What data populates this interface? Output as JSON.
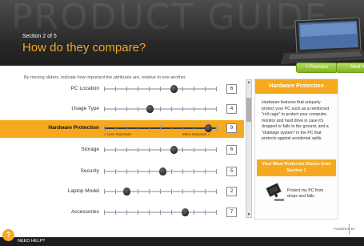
{
  "header": {
    "watermark": "PRODUCT GUIDE",
    "section_label": "Section 2 of 5",
    "title": "How do they compare?"
  },
  "instructions": "By moving sliders, indicate how important the attributes are, relative to one another.",
  "nav": {
    "previous_label": "< Previous",
    "next_label": "Next >"
  },
  "sliders": [
    {
      "label": "PC Location",
      "value": "6",
      "position": 0.62
    },
    {
      "label": "Usage Type",
      "value": "4",
      "position": 0.41
    },
    {
      "label": "Hardware Protection",
      "value": "9",
      "position": 0.93,
      "highlight": true,
      "less_label": "« Less Important",
      "more_label": "More Important »"
    },
    {
      "label": "Storage",
      "value": "6",
      "position": 0.62
    },
    {
      "label": "Security",
      "value": "5",
      "position": 0.52
    },
    {
      "label": "Laptop Model",
      "value": "2",
      "position": 0.2
    },
    {
      "label": "Accessories",
      "value": "7",
      "position": 0.72
    }
  ],
  "info_panel": {
    "title": "Hardware Protection",
    "body": "Hardware features that uniquely protect your PC such as a reinforced \"roll cage\" to protect your computer, monitor and hard drive in case it's dropped or falls to the ground, and a \"drainage system\" in the PC that protects against accidental spills.",
    "preferred_heading": "Your Most Preferred Choice from Section 1",
    "preferred_choice": "Protect my PC from drops and falls"
  },
  "footer": {
    "help_glyph": "?",
    "help_label": "NEED HELP?",
    "powered_by": "POWERED BY"
  },
  "colors": {
    "accent": "#f6a91f",
    "nav_green": "#7db324",
    "header_dark": "#262626"
  }
}
